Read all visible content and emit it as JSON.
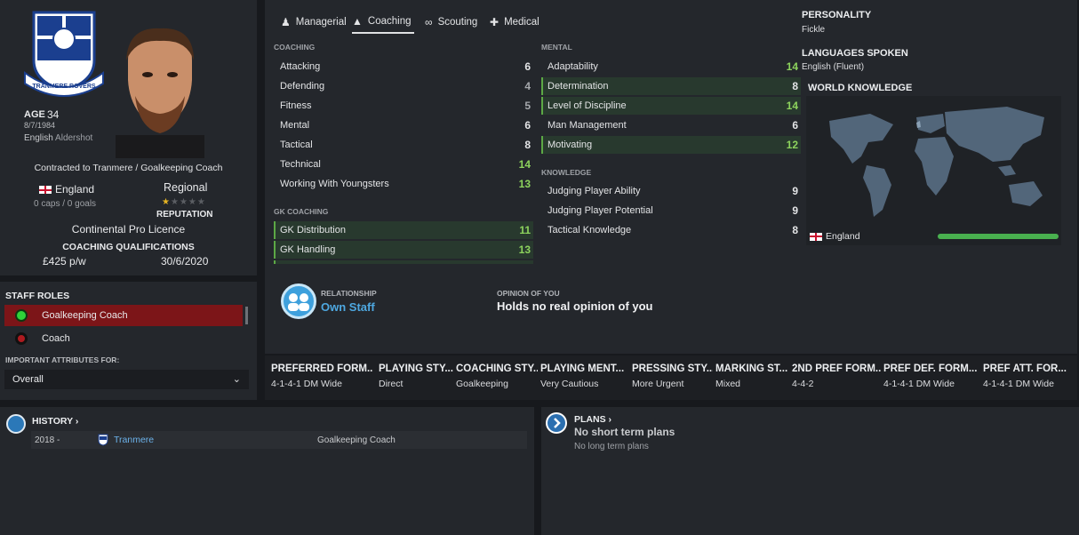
{
  "profile": {
    "age_label": "AGE",
    "age": "34",
    "dob": "8/7/1984",
    "nationality_word": "English",
    "birthplace": "Aldershot",
    "contract": "Contracted to Tranmere / Goalkeeping Coach",
    "nation": "England",
    "caps": "0 caps / 0 goals",
    "reputation_level": "Regional",
    "reputation_label": "REPUTATION",
    "reputation_stars": 1,
    "licence": "Continental Pro Licence",
    "qualifications_label": "COACHING QUALIFICATIONS",
    "wage": "£425 p/w",
    "contract_expiry": "30/6/2020",
    "club_crest": "Tranmere Rovers crest",
    "crest_text": "TRANMERE ROVERS"
  },
  "staff_roles": {
    "title": "STAFF ROLES",
    "items": [
      {
        "label": "Goalkeeping Coach",
        "selected": true,
        "color": "#2fd339"
      },
      {
        "label": "Coach",
        "selected": false,
        "color": "#ad1a1f"
      }
    ],
    "important_label": "IMPORTANT ATTRIBUTES FOR:",
    "dropdown_value": "Overall"
  },
  "tabs": [
    {
      "label": "Managerial",
      "icon": "managerial-icon"
    },
    {
      "label": "Coaching",
      "icon": "coaching-icon"
    },
    {
      "label": "Scouting",
      "icon": "binoculars-icon"
    },
    {
      "label": "Medical",
      "icon": "medical-kit-icon"
    }
  ],
  "coaching": {
    "title": "COACHING",
    "items": [
      {
        "label": "Attacking",
        "value": "6"
      },
      {
        "label": "Defending",
        "value": "4"
      },
      {
        "label": "Fitness",
        "value": "5"
      },
      {
        "label": "Mental",
        "value": "6"
      },
      {
        "label": "Tactical",
        "value": "8"
      },
      {
        "label": "Technical",
        "value": "14"
      },
      {
        "label": "Working With Youngsters",
        "value": "13"
      }
    ]
  },
  "gk_coaching": {
    "title": "GK COACHING",
    "items": [
      {
        "label": "GK Distribution",
        "value": "11"
      },
      {
        "label": "GK Handling",
        "value": "13"
      }
    ]
  },
  "mental": {
    "title": "MENTAL",
    "items": [
      {
        "label": "Adaptability",
        "value": "14"
      },
      {
        "label": "Determination",
        "value": "8"
      },
      {
        "label": "Level of Discipline",
        "value": "14"
      },
      {
        "label": "Man Management",
        "value": "6"
      },
      {
        "label": "Motivating",
        "value": "12"
      }
    ]
  },
  "knowledge": {
    "title": "KNOWLEDGE",
    "items": [
      {
        "label": "Judging Player Ability",
        "value": "9"
      },
      {
        "label": "Judging Player Potential",
        "value": "9"
      },
      {
        "label": "Tactical Knowledge",
        "value": "8"
      }
    ]
  },
  "personality": {
    "title": "PERSONALITY",
    "value": "Fickle"
  },
  "languages": {
    "title": "LANGUAGES SPOKEN",
    "value": "English (Fluent)"
  },
  "world_knowledge": {
    "title": "WORLD KNOWLEDGE",
    "country": "England",
    "level": 1.0
  },
  "relationship": {
    "label": "RELATIONSHIP",
    "value": "Own Staff"
  },
  "opinion": {
    "label": "OPINION OF YOU",
    "value": "Holds no real opinion of you"
  },
  "tactics": [
    {
      "header": "PREFERRED FORM...",
      "value": "4-1-4-1 DM Wide"
    },
    {
      "header": "PLAYING STY...",
      "value": "Direct"
    },
    {
      "header": "COACHING STY...",
      "value": "Goalkeeping"
    },
    {
      "header": "PLAYING MENT...",
      "value": "Very Cautious"
    },
    {
      "header": "PRESSING STY...",
      "value": "More Urgent"
    },
    {
      "header": "MARKING ST...",
      "value": "Mixed"
    },
    {
      "header": "2ND PREF FORM...",
      "value": "4-4-2"
    },
    {
      "header": "PREF DEF. FORM...",
      "value": "4-1-4-1 DM Wide"
    },
    {
      "header": "PREF ATT. FOR...",
      "value": "4-1-4-1 DM Wide"
    }
  ],
  "history": {
    "title": "HISTORY",
    "rows": [
      {
        "year": "2018 -",
        "club": "Tranmere",
        "role": "Goalkeeping Coach"
      }
    ]
  },
  "plans": {
    "title": "PLANS",
    "short": "No short term plans",
    "long": "No long term plans"
  }
}
